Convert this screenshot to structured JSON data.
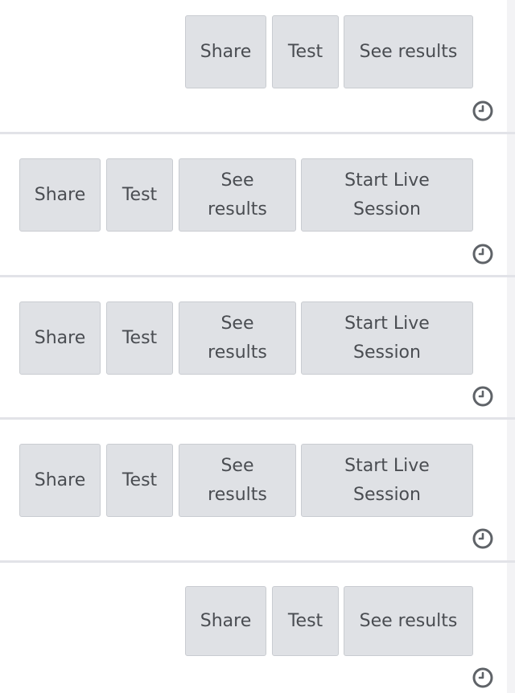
{
  "cards": [
    {
      "buttons": [
        "Share",
        "Test",
        "See results"
      ],
      "icon": "clock-icon"
    },
    {
      "buttons": [
        "Share",
        "Test",
        "See results",
        "Start Live Session"
      ],
      "icon": "clock-icon"
    },
    {
      "buttons": [
        "Share",
        "Test",
        "See results",
        "Start Live Session"
      ],
      "icon": "clock-icon"
    },
    {
      "buttons": [
        "Share",
        "Test",
        "See results",
        "Start Live Session"
      ],
      "icon": "clock-icon"
    },
    {
      "buttons": [
        "Share",
        "Test",
        "See results"
      ],
      "icon": "clock-icon"
    }
  ],
  "colors": {
    "button_bg": "#dfe1e5",
    "button_text": "#4a4d52",
    "divider": "#e2e3e8",
    "icon": "#5f6368"
  }
}
